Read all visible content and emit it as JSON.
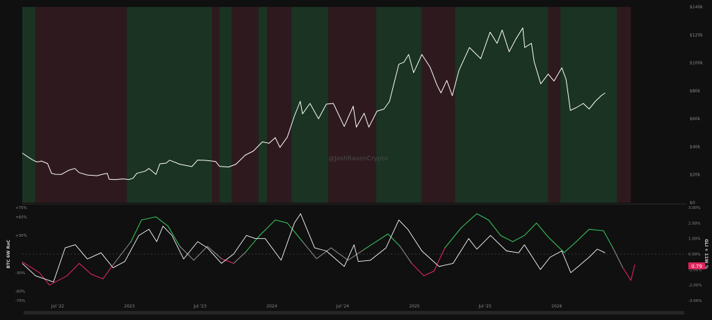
{
  "watermark": "@JoshRavenCrypto",
  "badge_value": "0.79",
  "colors": {
    "background": "#101010",
    "band_green": "#1b3322",
    "band_red": "#2e1a1e",
    "price_line": "#ffffff",
    "osc_green": "#36c25a",
    "osc_red": "#e0245e",
    "osc_neutral": "#8a8a8a",
    "badge_bg": "#e0245e"
  },
  "chart_data": [
    {
      "type": "line",
      "title": "",
      "series": [
        {
          "name": "",
          "values": []
        }
      ],
      "x_start": "2022-04",
      "x_end": "2026-12",
      "x_ticks": [
        "Jul '22",
        "2023",
        "Jul '23",
        "2024",
        "Jul '24",
        "2025",
        "Jul '25",
        "2026"
      ],
      "y_ticks": [
        "$0",
        "$20k",
        "$40k",
        "$60k",
        "$80k",
        "$100k",
        "$120k",
        "$140k"
      ],
      "ylim": [
        0,
        140000
      ],
      "y_axis_side": "right",
      "grid": false,
      "price_points": [
        [
          "2022-04-01",
          35500
        ],
        [
          "2022-04-10",
          33800
        ],
        [
          "2022-04-25",
          31000
        ],
        [
          "2022-05-05",
          29500
        ],
        [
          "2022-05-12",
          29200
        ],
        [
          "2022-05-20",
          29800
        ],
        [
          "2022-06-05",
          28000
        ],
        [
          "2022-06-15",
          21000
        ],
        [
          "2022-06-25",
          20300
        ],
        [
          "2022-07-10",
          20200
        ],
        [
          "2022-07-30",
          23300
        ],
        [
          "2022-08-14",
          24500
        ],
        [
          "2022-08-25",
          21500
        ],
        [
          "2022-09-15",
          19800
        ],
        [
          "2022-10-10",
          19300
        ],
        [
          "2022-10-25",
          20400
        ],
        [
          "2022-11-05",
          21000
        ],
        [
          "2022-11-10",
          16800
        ],
        [
          "2022-11-25",
          16500
        ],
        [
          "2022-12-15",
          17000
        ],
        [
          "2022-12-31",
          16600
        ],
        [
          "2023-01-10",
          17500
        ],
        [
          "2023-01-20",
          21000
        ],
        [
          "2023-02-10",
          22500
        ],
        [
          "2023-02-20",
          24500
        ],
        [
          "2023-03-10",
          20200
        ],
        [
          "2023-03-20",
          27800
        ],
        [
          "2023-04-05",
          28300
        ],
        [
          "2023-04-14",
          30400
        ],
        [
          "2023-05-10",
          27500
        ],
        [
          "2023-06-10",
          25800
        ],
        [
          "2023-06-25",
          30500
        ],
        [
          "2023-07-15",
          30300
        ],
        [
          "2023-08-10",
          29500
        ],
        [
          "2023-08-20",
          26000
        ],
        [
          "2023-09-12",
          25500
        ],
        [
          "2023-10-01",
          27500
        ],
        [
          "2023-10-25",
          34000
        ],
        [
          "2023-11-15",
          37000
        ],
        [
          "2023-12-08",
          43500
        ],
        [
          "2023-12-25",
          42500
        ],
        [
          "2024-01-10",
          46500
        ],
        [
          "2024-01-22",
          39500
        ],
        [
          "2024-02-10",
          47000
        ],
        [
          "2024-02-28",
          62000
        ],
        [
          "2024-03-14",
          72500
        ],
        [
          "2024-03-20",
          63500
        ],
        [
          "2024-04-08",
          71000
        ],
        [
          "2024-04-30",
          60000
        ],
        [
          "2024-05-20",
          70500
        ],
        [
          "2024-06-07",
          71000
        ],
        [
          "2024-07-05",
          54500
        ],
        [
          "2024-07-28",
          69000
        ],
        [
          "2024-08-05",
          54000
        ],
        [
          "2024-08-25",
          64000
        ],
        [
          "2024-09-06",
          54000
        ],
        [
          "2024-09-27",
          65500
        ],
        [
          "2024-10-15",
          67000
        ],
        [
          "2024-10-29",
          72500
        ],
        [
          "2024-11-12",
          88000
        ],
        [
          "2024-11-22",
          99000
        ],
        [
          "2024-12-05",
          100500
        ],
        [
          "2024-12-17",
          106000
        ],
        [
          "2024-12-30",
          93000
        ],
        [
          "2025-01-20",
          106000
        ],
        [
          "2025-02-10",
          97000
        ],
        [
          "2025-02-28",
          84000
        ],
        [
          "2025-03-10",
          78500
        ],
        [
          "2025-03-25",
          87500
        ],
        [
          "2025-04-08",
          76500
        ],
        [
          "2025-04-25",
          94500
        ],
        [
          "2025-05-22",
          111000
        ],
        [
          "2025-06-20",
          103000
        ],
        [
          "2025-07-14",
          122000
        ],
        [
          "2025-08-01",
          114000
        ],
        [
          "2025-08-14",
          123500
        ],
        [
          "2025-09-01",
          108000
        ],
        [
          "2025-09-18",
          117000
        ],
        [
          "2025-10-06",
          125000
        ],
        [
          "2025-10-11",
          111000
        ],
        [
          "2025-10-28",
          114000
        ],
        [
          "2025-11-04",
          101000
        ],
        [
          "2025-11-21",
          85000
        ],
        [
          "2025-12-10",
          92000
        ],
        [
          "2025-12-25",
          87000
        ],
        [
          "2026-01-14",
          96500
        ],
        [
          "2026-01-25",
          88000
        ],
        [
          "2026-02-05",
          66000
        ],
        [
          "2026-02-20",
          68000
        ],
        [
          "2026-03-10",
          71000
        ],
        [
          "2026-03-25",
          67000
        ],
        [
          "2026-04-10",
          72500
        ],
        [
          "2026-04-25",
          76500
        ],
        [
          "2026-05-05",
          78500
        ]
      ],
      "regimes": [
        {
          "start": "2022-04-01",
          "end": "2022-05-05",
          "state": "bullish"
        },
        {
          "start": "2022-05-05",
          "end": "2022-12-25",
          "state": "bearish"
        },
        {
          "start": "2022-12-25",
          "end": "2023-08-01",
          "state": "bullish"
        },
        {
          "start": "2023-08-01",
          "end": "2023-08-20",
          "state": "bearish"
        },
        {
          "start": "2023-08-20",
          "end": "2023-09-20",
          "state": "bullish"
        },
        {
          "start": "2023-09-20",
          "end": "2023-11-28",
          "state": "bearish"
        },
        {
          "start": "2023-11-28",
          "end": "2023-12-20",
          "state": "bullish"
        },
        {
          "start": "2023-12-20",
          "end": "2024-02-20",
          "state": "bearish"
        },
        {
          "start": "2024-02-20",
          "end": "2024-05-25",
          "state": "bullish"
        },
        {
          "start": "2024-05-25",
          "end": "2024-09-25",
          "state": "bearish"
        },
        {
          "start": "2024-09-25",
          "end": "2025-01-20",
          "state": "bullish"
        },
        {
          "start": "2025-01-20",
          "end": "2025-04-15",
          "state": "bearish"
        },
        {
          "start": "2025-04-15",
          "end": "2025-12-10",
          "state": "bullish"
        },
        {
          "start": "2025-12-10",
          "end": "2026-01-10",
          "state": "bearish"
        },
        {
          "start": "2026-01-10",
          "end": "2026-06-05",
          "state": "bullish"
        },
        {
          "start": "2026-06-05",
          "end": "2026-07-10",
          "state": "bearish"
        }
      ]
    },
    {
      "type": "line",
      "title": "",
      "left_axis_label": "BTC 6W RoC",
      "right_axis_label": "GLI + 11W %",
      "left_ticks": [
        "+75%",
        "+60%",
        "+30%",
        "-30%",
        "-60%",
        "-75%"
      ],
      "left_tick_values": [
        75,
        60,
        30,
        -30,
        -60,
        -75
      ],
      "left_ylim": [
        -75,
        75
      ],
      "right_ticks": [
        "3.00%",
        "2.00%",
        "1.00%",
        "0.00%",
        "-1.00%",
        "-2.00%",
        "-3.00%"
      ],
      "right_tick_values": [
        3,
        2,
        1,
        0,
        -1,
        -2,
        -3
      ],
      "right_ylim": [
        -3,
        3
      ],
      "series": [
        {
          "name": "",
          "color": "#ffffff",
          "points": [
            [
              "2022-04-01",
              -15
            ],
            [
              "2022-05-05",
              -35
            ],
            [
              "2022-06-20",
              -45
            ],
            [
              "2022-07-20",
              10
            ],
            [
              "2022-08-15",
              15
            ],
            [
              "2022-09-15",
              -8
            ],
            [
              "2022-10-20",
              2
            ],
            [
              "2022-11-20",
              -22
            ],
            [
              "2022-12-20",
              -12
            ],
            [
              "2023-01-25",
              30
            ],
            [
              "2023-02-20",
              40
            ],
            [
              "2023-03-12",
              20
            ],
            [
              "2023-03-28",
              45
            ],
            [
              "2023-04-20",
              30
            ],
            [
              "2023-05-20",
              -8
            ],
            [
              "2023-06-25",
              20
            ],
            [
              "2023-07-20",
              10
            ],
            [
              "2023-08-25",
              -15
            ],
            [
              "2023-09-25",
              0
            ],
            [
              "2023-10-28",
              30
            ],
            [
              "2023-11-20",
              25
            ],
            [
              "2023-12-15",
              25
            ],
            [
              "2024-01-25",
              -10
            ],
            [
              "2024-02-28",
              50
            ],
            [
              "2024-03-15",
              65
            ],
            [
              "2024-04-20",
              10
            ],
            [
              "2024-05-20",
              5
            ],
            [
              "2024-07-05",
              -20
            ],
            [
              "2024-07-30",
              15
            ],
            [
              "2024-08-10",
              -12
            ],
            [
              "2024-09-10",
              -10
            ],
            [
              "2024-10-20",
              10
            ],
            [
              "2024-11-22",
              55
            ],
            [
              "2024-12-15",
              40
            ],
            [
              "2025-01-20",
              5
            ],
            [
              "2025-03-05",
              -20
            ],
            [
              "2025-04-10",
              -15
            ],
            [
              "2025-05-20",
              25
            ],
            [
              "2025-06-10",
              8
            ],
            [
              "2025-07-15",
              30
            ],
            [
              "2025-08-25",
              5
            ],
            [
              "2025-09-25",
              2
            ],
            [
              "2025-10-10",
              15
            ],
            [
              "2025-11-20",
              -25
            ],
            [
              "2025-12-15",
              -5
            ],
            [
              "2026-01-14",
              5
            ],
            [
              "2026-02-06",
              -30
            ],
            [
              "2026-02-25",
              -20
            ],
            [
              "2026-03-25",
              -5
            ],
            [
              "2026-04-15",
              8
            ],
            [
              "2026-05-05",
              2
            ]
          ]
        },
        {
          "name": "",
          "color": "#36c25a",
          "points": [
            [
              "2022-04-01",
              -0.5
            ],
            [
              "2022-05-15",
              -1.2
            ],
            [
              "2022-06-10",
              -2.0
            ],
            [
              "2022-07-25",
              -1.4
            ],
            [
              "2022-08-25",
              -0.6
            ],
            [
              "2022-09-25",
              -1.3
            ],
            [
              "2022-10-25",
              -1.6
            ],
            [
              "2022-11-20",
              -0.7
            ],
            [
              "2023-01-05",
              0.8
            ],
            [
              "2023-02-01",
              2.2
            ],
            [
              "2023-03-10",
              2.4
            ],
            [
              "2023-04-10",
              1.8
            ],
            [
              "2023-05-10",
              0.5
            ],
            [
              "2023-06-15",
              -0.4
            ],
            [
              "2023-07-20",
              0.5
            ],
            [
              "2023-08-25",
              -0.3
            ],
            [
              "2023-09-25",
              -0.6
            ],
            [
              "2023-10-25",
              0.1
            ],
            [
              "2023-12-01",
              1.2
            ],
            [
              "2024-01-10",
              2.2
            ],
            [
              "2024-02-10",
              2.0
            ],
            [
              "2024-03-20",
              0.8
            ],
            [
              "2024-04-25",
              -0.3
            ],
            [
              "2024-06-01",
              0.4
            ],
            [
              "2024-07-15",
              -0.4
            ],
            [
              "2024-08-25",
              0.3
            ],
            [
              "2024-09-25",
              0.8
            ],
            [
              "2024-10-25",
              1.3
            ],
            [
              "2024-11-25",
              0.5
            ],
            [
              "2024-12-25",
              -0.6
            ],
            [
              "2025-01-25",
              -1.4
            ],
            [
              "2025-02-20",
              -1.1
            ],
            [
              "2025-03-20",
              0.4
            ],
            [
              "2025-05-01",
              1.7
            ],
            [
              "2025-06-10",
              2.6
            ],
            [
              "2025-07-10",
              2.2
            ],
            [
              "2025-08-10",
              1.2
            ],
            [
              "2025-09-10",
              0.8
            ],
            [
              "2025-10-10",
              1.2
            ],
            [
              "2025-11-10",
              2.0
            ],
            [
              "2025-12-10",
              1.1
            ],
            [
              "2026-01-20",
              0.1
            ],
            [
              "2026-02-20",
              0.8
            ],
            [
              "2026-03-25",
              1.6
            ],
            [
              "2026-05-01",
              1.5
            ],
            [
              "2026-05-25",
              0.4
            ],
            [
              "2026-06-20",
              -0.9
            ],
            [
              "2026-07-10",
              -1.7
            ],
            [
              "2026-07-20",
              -0.7
            ]
          ]
        }
      ]
    }
  ]
}
